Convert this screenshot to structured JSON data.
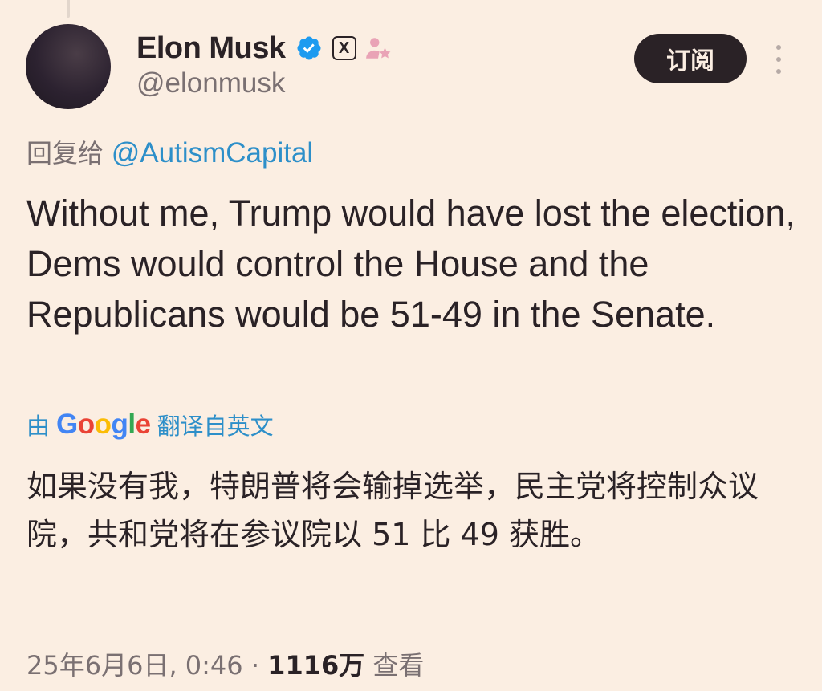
{
  "author": {
    "display_name": "Elon Musk",
    "handle": "@elonmusk",
    "verified_color": "#1d9bf0",
    "affiliation_badge": "X",
    "badges": [
      "verified-badge-icon",
      "x-affiliation-icon",
      "person-star-icon"
    ]
  },
  "actions": {
    "subscribe_label": "订阅",
    "more_icon": "more-vertical-icon"
  },
  "reply": {
    "prefix": "回复给",
    "mention": "@AutismCapital"
  },
  "tweet": {
    "text": "Without me, Trump would have lost the election, Dems would control the House and the Republicans would be 51-49 in the Senate."
  },
  "translation": {
    "prefix": "由",
    "provider_letters": [
      "G",
      "o",
      "o",
      "g",
      "l",
      "e"
    ],
    "provider_colors": [
      "#4285f4",
      "#ea4335",
      "#fbbc05",
      "#4285f4",
      "#34a853",
      "#ea4335"
    ],
    "suffix": "翻译自英文",
    "text": "如果没有我，特朗普将会输掉选举，民主党将控制众议院，共和党将在参议院以 51 比 49 获胜。"
  },
  "meta": {
    "timestamp": "25年6月6日, 0:46",
    "separator": "·",
    "views_count": "1116万",
    "views_label": "查看"
  },
  "colors": {
    "background": "#fbeee2",
    "text": "#2a2226",
    "muted": "#7a7072",
    "link": "#2d8fc9"
  }
}
